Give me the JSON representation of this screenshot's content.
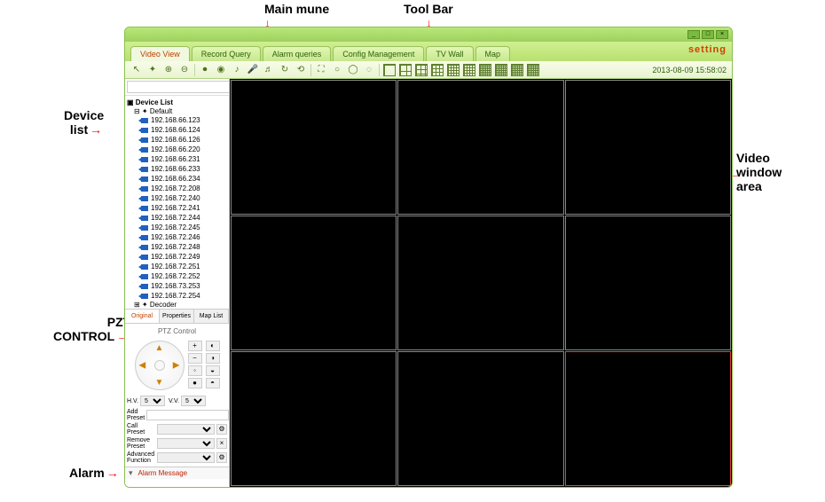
{
  "callouts": {
    "main_menu": "Main mune",
    "tool_bar": "Tool Bar",
    "device_list": "Device\nlist",
    "video_area": "Video\nwindow\narea",
    "ptz_control": "PZT\nCONTROL",
    "alarm": "Alarm",
    "setting": "setting"
  },
  "menu": {
    "tabs": [
      "Video View",
      "Record Query",
      "Alarm queries",
      "Config Management",
      "TV Wall",
      "Map"
    ],
    "active": 0
  },
  "toolbar": {
    "timestamp": "2013-08-09 15:58:02"
  },
  "sidebar": {
    "root": "Device List",
    "group": "Default",
    "devices": [
      "192.168.66.123",
      "192.168.66.124",
      "192.168.66.126",
      "192.168.66.220",
      "192.168.66.231",
      "192.168.66.233",
      "192.168.66.234",
      "192.168.72.208",
      "192.168.72.240",
      "192.168.72.241",
      "192.168.72.244",
      "192.168.72.245",
      "192.168.72.246",
      "192.168.72.248",
      "192.168.72.249",
      "192.168.72.251",
      "192.168.72.252",
      "192.168.73.253",
      "192.168.72.254"
    ],
    "decoder": "Decoder",
    "tabs": [
      "Original",
      "Properties",
      "Map List"
    ],
    "active_tab": 0
  },
  "ptz": {
    "title": "PTZ Control",
    "hv_label": "H.V.",
    "vv_label": "V.V.",
    "hv_value": "5",
    "vv_value": "5",
    "add_preset": "Add Preset",
    "call_preset": "Call Preset",
    "remove_preset": "Remove\nPreset",
    "advanced": "Advanced\nFunction"
  },
  "alarm": {
    "label": "Alarm Message"
  }
}
